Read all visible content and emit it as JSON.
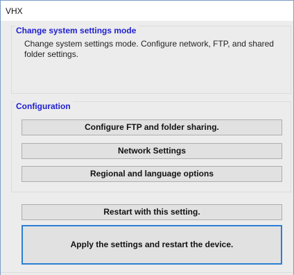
{
  "window": {
    "title": "VHX"
  },
  "mode_group": {
    "label": "Change system settings mode",
    "description": "Change system settings mode. Configure network, FTP, and shared folder settings."
  },
  "config_group": {
    "label": "Configuration",
    "buttons": {
      "ftp": "Configure FTP and folder sharing.",
      "network": "Network Settings",
      "regional": "Regional and language options"
    }
  },
  "actions": {
    "restart": "Restart with this setting.",
    "apply": "Apply the settings and restart the device."
  },
  "colors": {
    "group_label": "#2020d0",
    "focus_border": "#2a7fd4"
  }
}
